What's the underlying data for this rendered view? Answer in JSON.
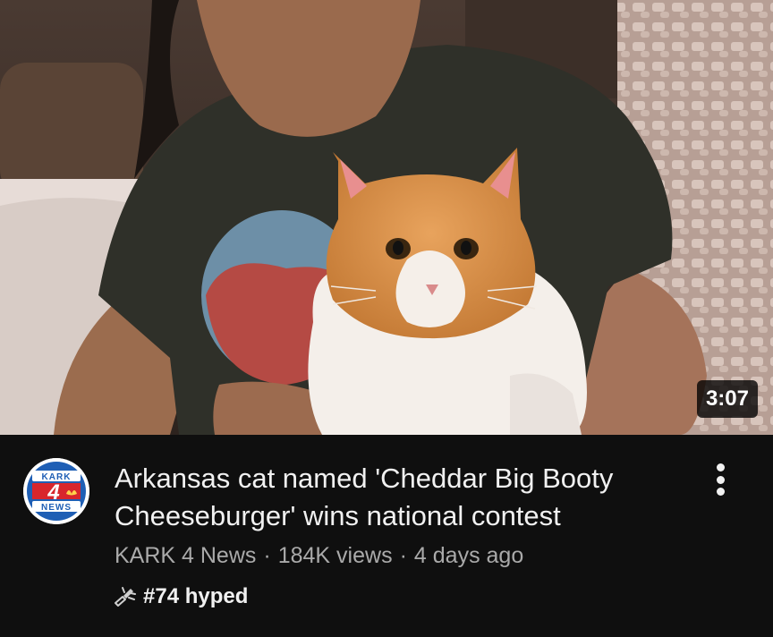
{
  "video": {
    "duration": "3:07",
    "title": "Arkansas cat named 'Cheddar Big Booty Cheeseburger' wins national contest",
    "channel": "KARK 4 News",
    "views": "184K views",
    "age": "4 days ago",
    "separator": "·",
    "hype": "#74 hyped"
  },
  "channel_logo": {
    "top_text": "KARK",
    "number": "4",
    "bottom_text": "NEWS",
    "colors": {
      "blue": "#1f5fb5",
      "red": "#d8262c"
    }
  },
  "icons": {
    "hype": "hype-megaphone-icon",
    "more": "more-vert-icon"
  }
}
